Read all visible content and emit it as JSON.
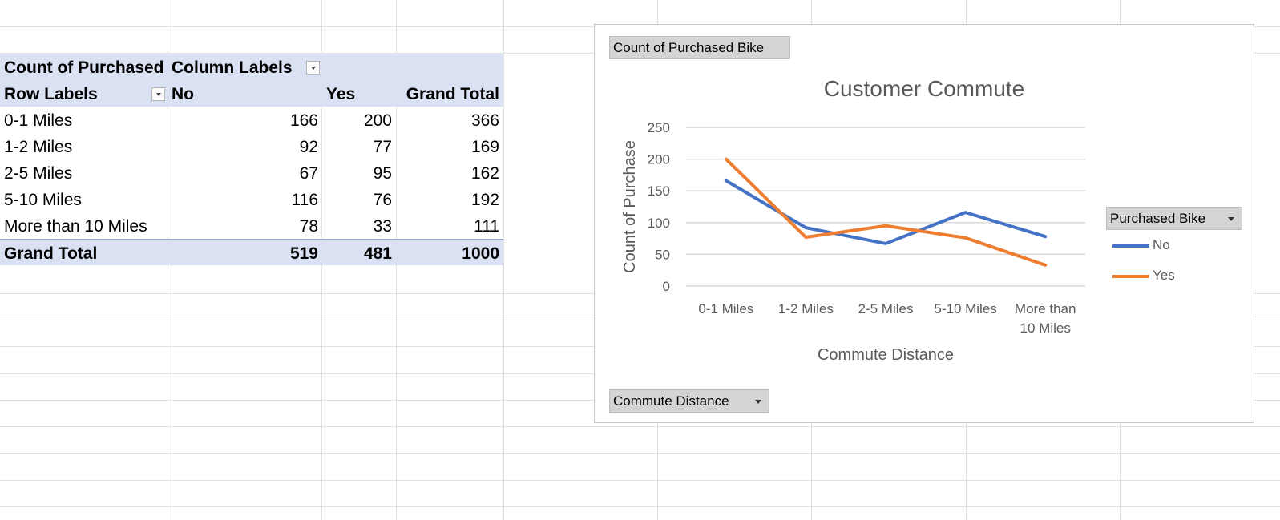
{
  "pivot": {
    "corner_label": "Count of Purchased",
    "column_labels": "Column Labels",
    "row_labels": "Row Labels",
    "headers": [
      "No",
      "Yes",
      "Grand Total"
    ],
    "rows": [
      {
        "label": "0-1 Miles",
        "no": "166",
        "yes": "200",
        "total": "366"
      },
      {
        "label": "1-2 Miles",
        "no": "92",
        "yes": "77",
        "total": "169"
      },
      {
        "label": "2-5 Miles",
        "no": "67",
        "yes": "95",
        "total": "162"
      },
      {
        "label": "5-10 Miles",
        "no": "116",
        "yes": "76",
        "total": "192"
      },
      {
        "label": "More than 10 Miles",
        "no": "78",
        "yes": "33",
        "total": "111"
      }
    ],
    "grand_total": {
      "label": "Grand Total",
      "no": "519",
      "yes": "481",
      "total": "1000"
    }
  },
  "chart": {
    "value_field_button": "Count of Purchased Bike",
    "legend_field_button": "Purchased Bike",
    "axis_field_button": "Commute Distance"
  },
  "chart_data": {
    "type": "line",
    "title": "Customer Commute",
    "xlabel": "Commute Distance",
    "ylabel": "Count of Purchase",
    "categories": [
      "0-1 Miles",
      "1-2 Miles",
      "2-5 Miles",
      "5-10 Miles",
      "More than 10 Miles"
    ],
    "series": [
      {
        "name": "No",
        "values": [
          166,
          92,
          67,
          116,
          78
        ],
        "color": "#4472c4"
      },
      {
        "name": "Yes",
        "values": [
          200,
          77,
          95,
          76,
          33
        ],
        "color": "#ed7d31"
      }
    ],
    "ylim": [
      0,
      250
    ],
    "yticks": [
      0,
      50,
      100,
      150,
      200,
      250
    ],
    "grid": true,
    "legend_position": "right"
  }
}
